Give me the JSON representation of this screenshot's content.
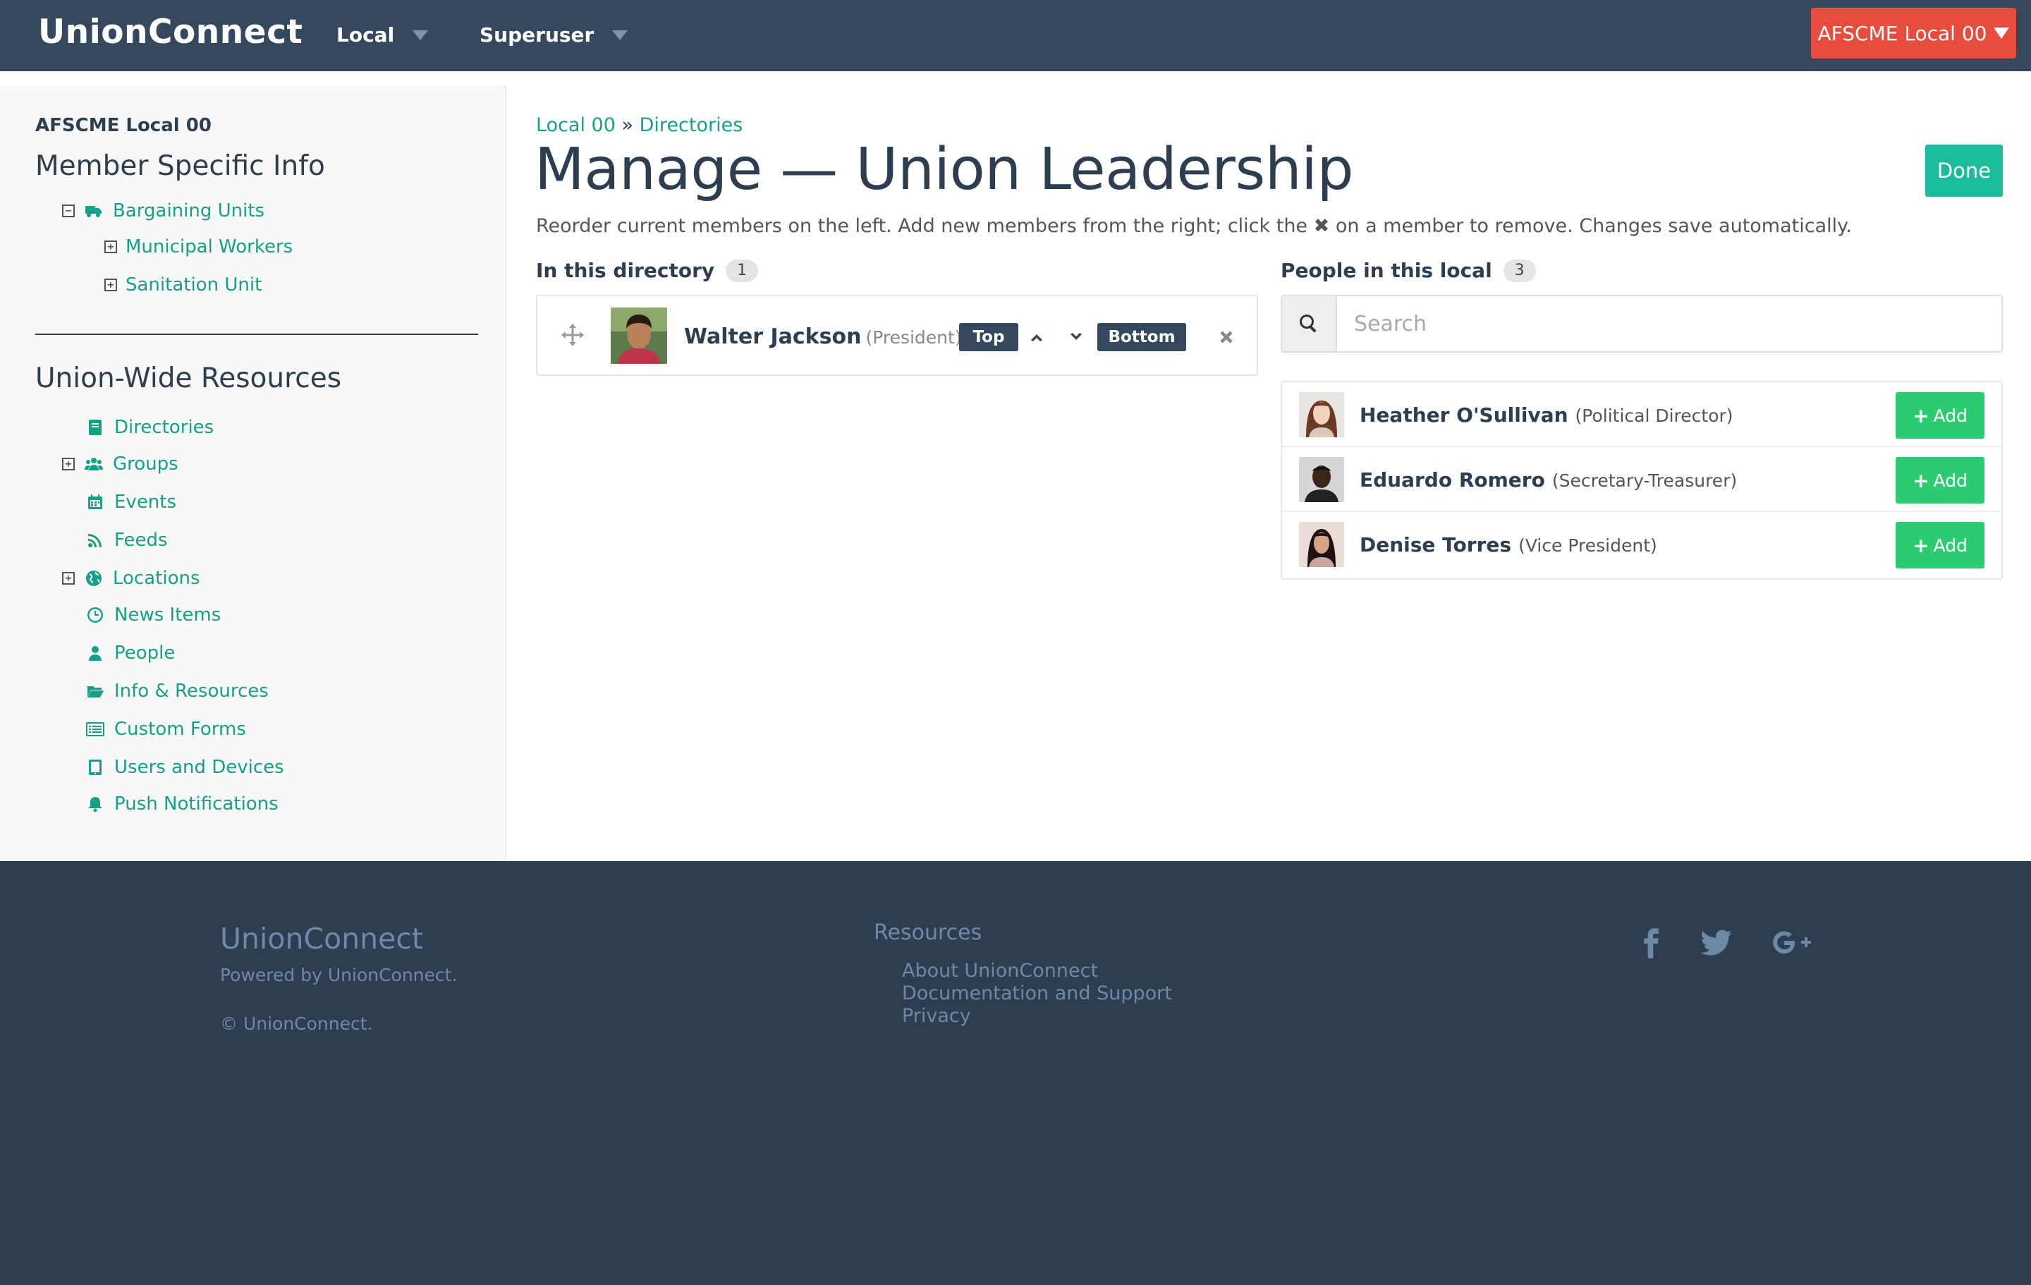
{
  "navbar": {
    "brand": "UnionConnect",
    "local_menu": "Local",
    "superuser_menu": "Superuser",
    "local_selector": "AFSCME Local 00"
  },
  "sidebar": {
    "local_name": "AFSCME Local 00",
    "member_heading": "Member Specific Info",
    "bargaining_units": "Bargaining Units",
    "units": [
      "Municipal Workers",
      "Sanitation Unit"
    ],
    "union_heading": "Union-Wide Resources",
    "resources": [
      {
        "label": "Directories",
        "icon": "book-icon",
        "expandable": false
      },
      {
        "label": "Groups",
        "icon": "users-icon",
        "expandable": true
      },
      {
        "label": "Events",
        "icon": "calendar-icon",
        "expandable": false
      },
      {
        "label": "Feeds",
        "icon": "rss-icon",
        "expandable": false
      },
      {
        "label": "Locations",
        "icon": "globe-icon",
        "expandable": true
      },
      {
        "label": "News Items",
        "icon": "clock-icon",
        "expandable": false
      },
      {
        "label": "People",
        "icon": "user-icon",
        "expandable": false
      },
      {
        "label": "Info & Resources",
        "icon": "folder-icon",
        "expandable": false
      },
      {
        "label": "Custom Forms",
        "icon": "list-icon",
        "expandable": false
      },
      {
        "label": "Users and Devices",
        "icon": "tablet-icon",
        "expandable": false
      },
      {
        "label": "Push Notifications",
        "icon": "bell-icon",
        "expandable": false
      }
    ]
  },
  "main": {
    "breadcrumb_local": "Local 00",
    "breadcrumb_sep": "»",
    "breadcrumb_dirs": "Directories",
    "title": "Manage — Union Leadership",
    "done": "Done",
    "instructions_before": "Reorder current members on the left. Add new members from the right; click the",
    "instructions_icon": "✖",
    "instructions_after": "on a member to remove. Changes save automatically.",
    "in_directory_label": "In this directory",
    "in_directory_count": "1",
    "people_label": "People in this local",
    "people_count": "3",
    "search_placeholder": "Search",
    "members": [
      {
        "name": "Walter Jackson",
        "role": "(President)"
      }
    ],
    "controls": {
      "top": "Top",
      "bottom": "Bottom"
    },
    "people": [
      {
        "name": "Heather O'Sullivan",
        "role": "(Political Director)",
        "add": "Add"
      },
      {
        "name": "Eduardo Romero",
        "role": "(Secretary-Treasurer)",
        "add": "Add"
      },
      {
        "name": "Denise Torres",
        "role": "(Vice President)",
        "add": "Add"
      }
    ]
  },
  "footer": {
    "brand": "UnionConnect",
    "powered": "Powered by UnionConnect.",
    "copyright": "© UnionConnect.",
    "resources_title": "Resources",
    "links": [
      "About UnionConnect",
      "Documentation and Support",
      "Privacy"
    ]
  },
  "colors": {
    "navbar": "#34495e",
    "accent": "#16a085",
    "done": "#1abc9c",
    "add": "#2ecc71",
    "local_selector": "#e74c3c",
    "footer": "#2c3e50"
  }
}
